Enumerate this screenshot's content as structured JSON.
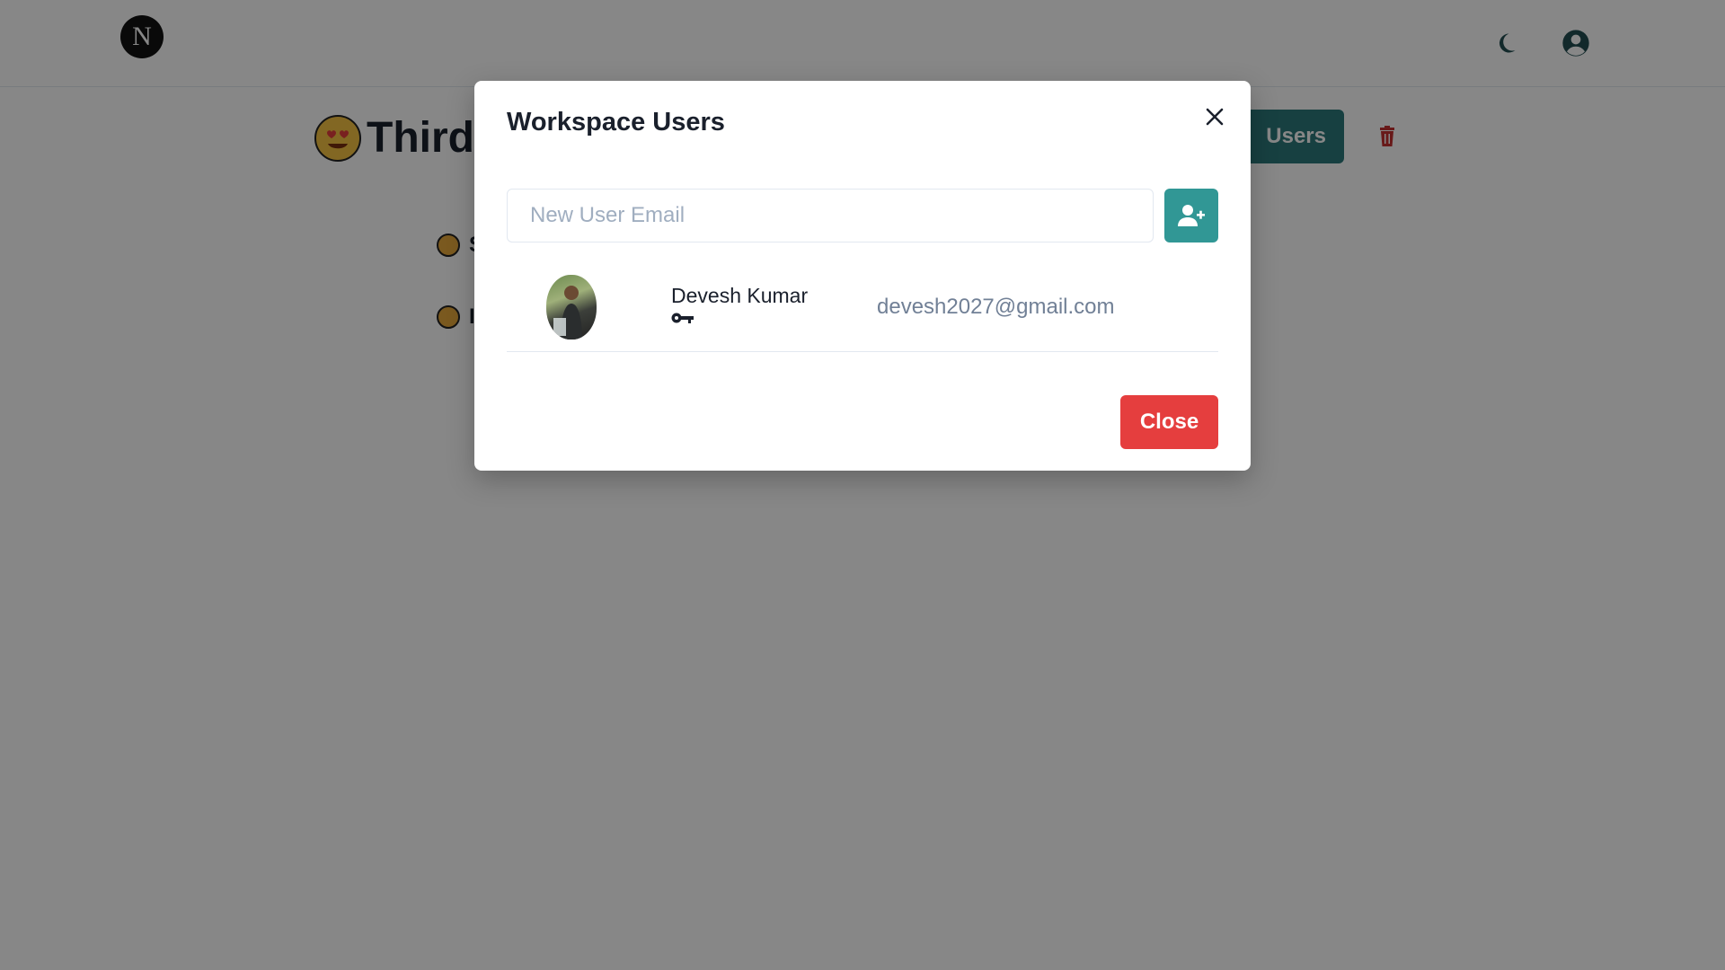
{
  "header": {
    "logo_letter": "N",
    "icons": [
      "moon-icon",
      "account-circle-icon"
    ],
    "accent_color": "#2c7a7b"
  },
  "workspace": {
    "title": "Third",
    "users_button_label": "Users",
    "pages": [
      {
        "emoji": "monkey-face",
        "label": "S"
      },
      {
        "emoji": "grimacing-face",
        "label": "I"
      }
    ]
  },
  "modal": {
    "title": "Workspace Users",
    "email_placeholder": "New User Email",
    "email_value": "",
    "users": [
      {
        "name": "Devesh Kumar",
        "email": "devesh2027@gmail.com",
        "role_icon": "key-icon"
      }
    ],
    "close_label": "Close",
    "close_color": "#e53e3e",
    "add_button_color": "#319795"
  }
}
